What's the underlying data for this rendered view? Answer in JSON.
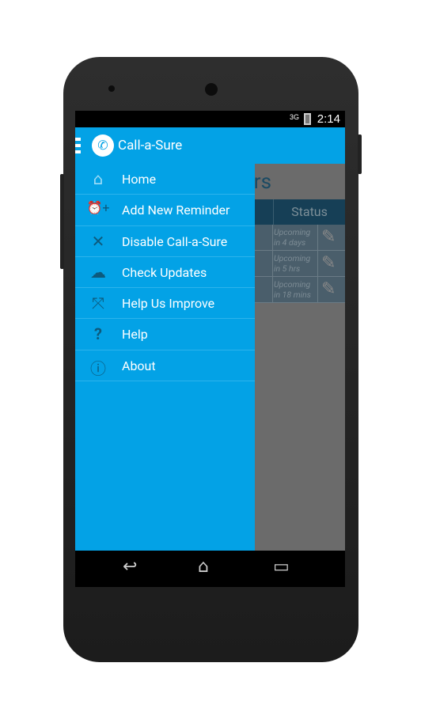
{
  "status_bar": {
    "network": "3G",
    "time": "2:14"
  },
  "action_bar": {
    "title": "Call-a-Sure"
  },
  "background_screen": {
    "title_fragment": "ers",
    "column_header": "Status",
    "rows": [
      {
        "status": "Upcoming in 4 days"
      },
      {
        "status": "Upcoming in 5 hrs"
      },
      {
        "status": "Upcoming in 18 mins"
      }
    ]
  },
  "drawer": {
    "items": [
      {
        "label": "Home",
        "icon": "home-icon"
      },
      {
        "label": "Add New Reminder",
        "icon": "alarm-add-icon"
      },
      {
        "label": "Disable Call-a-Sure",
        "icon": "close-icon"
      },
      {
        "label": "Check Updates",
        "icon": "cloud-icon"
      },
      {
        "label": "Help Us Improve",
        "icon": "expand-icon"
      },
      {
        "label": "Help",
        "icon": "question-icon"
      },
      {
        "label": "About",
        "icon": "info-icon"
      }
    ]
  },
  "colors": {
    "primary": "#03a2e6",
    "icon": "#0d5a7d"
  }
}
